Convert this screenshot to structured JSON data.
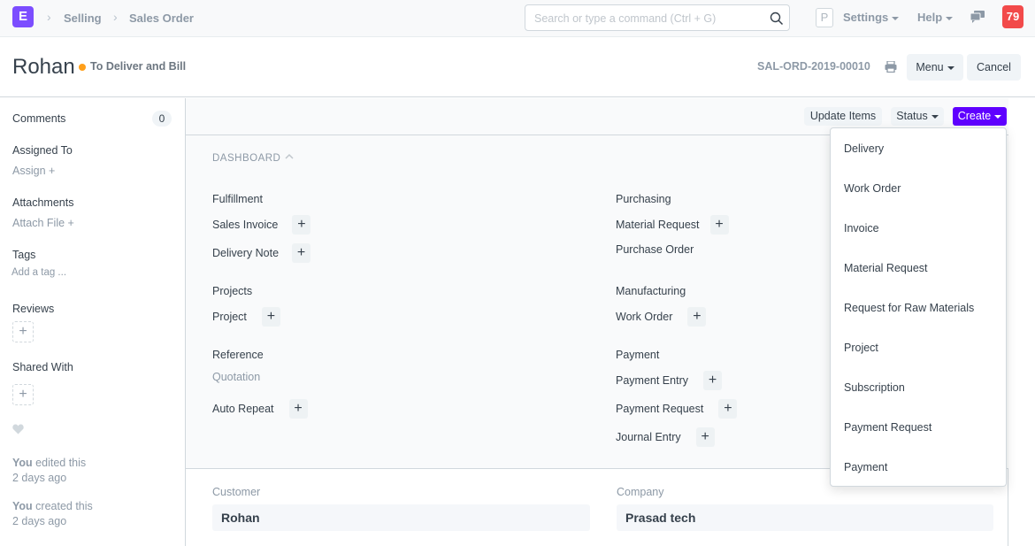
{
  "navbar": {
    "logo_letter": "E",
    "breadcrumbs": [
      "Selling",
      "Sales Order"
    ],
    "search_placeholder": "Search or type a command (Ctrl + G)",
    "avatar_letter": "P",
    "settings_label": "Settings",
    "help_label": "Help",
    "notification_count": "79"
  },
  "page_head": {
    "title": "Rohan",
    "status": "To Deliver and Bill",
    "status_color": "#ff9f1a",
    "doc_name": "SAL-ORD-2019-00010",
    "menu_label": "Menu",
    "cancel_label": "Cancel"
  },
  "sidebar": {
    "comments_label": "Comments",
    "comments_count": "0",
    "assigned_to_label": "Assigned To",
    "assign_link": "Assign +",
    "attachments_label": "Attachments",
    "attach_link": "Attach File +",
    "tags_label": "Tags",
    "add_tag_link": "Add a tag ...",
    "reviews_label": "Reviews",
    "shared_with_label": "Shared With",
    "activity": [
      {
        "who": "You",
        "action": " edited this",
        "when": "2 days ago"
      },
      {
        "who": "You",
        "action": " created this",
        "when": "2 days ago"
      }
    ]
  },
  "toolbar": {
    "update_items_label": "Update Items",
    "status_label": "Status",
    "create_label": "Create",
    "create_color": "#5f00ff"
  },
  "dashboard": {
    "title": "DASHBOARD",
    "groups": [
      {
        "title": "Fulfillment",
        "items": [
          {
            "label": "Sales Invoice",
            "add": true
          },
          {
            "label": "Delivery Note",
            "add": true
          }
        ]
      },
      {
        "title": "Projects",
        "items": [
          {
            "label": "Project",
            "add": true
          }
        ]
      },
      {
        "title": "Reference",
        "items": [
          {
            "label": "Quotation",
            "add": false
          },
          {
            "label": "Auto Repeat",
            "add": true
          }
        ]
      },
      {
        "title": "Purchasing",
        "items": [
          {
            "label": "Material Request",
            "add": true
          },
          {
            "label": "Purchase Order",
            "add": false
          }
        ]
      },
      {
        "title": "Manufacturing",
        "items": [
          {
            "label": "Work Order",
            "add": true
          }
        ]
      },
      {
        "title": "Payment",
        "items": [
          {
            "label": "Payment Entry",
            "add": true
          },
          {
            "label": "Payment Request",
            "add": true
          },
          {
            "label": "Journal Entry",
            "add": true
          }
        ]
      }
    ]
  },
  "fields": {
    "customer_label": "Customer",
    "customer_value": "Rohan",
    "company_label": "Company",
    "company_value": "Prasad tech"
  },
  "create_menu": {
    "items": [
      "Delivery",
      "Work Order",
      "Invoice",
      "Material Request",
      "Request for Raw Materials",
      "Project",
      "Subscription",
      "Payment Request",
      "Payment"
    ]
  }
}
